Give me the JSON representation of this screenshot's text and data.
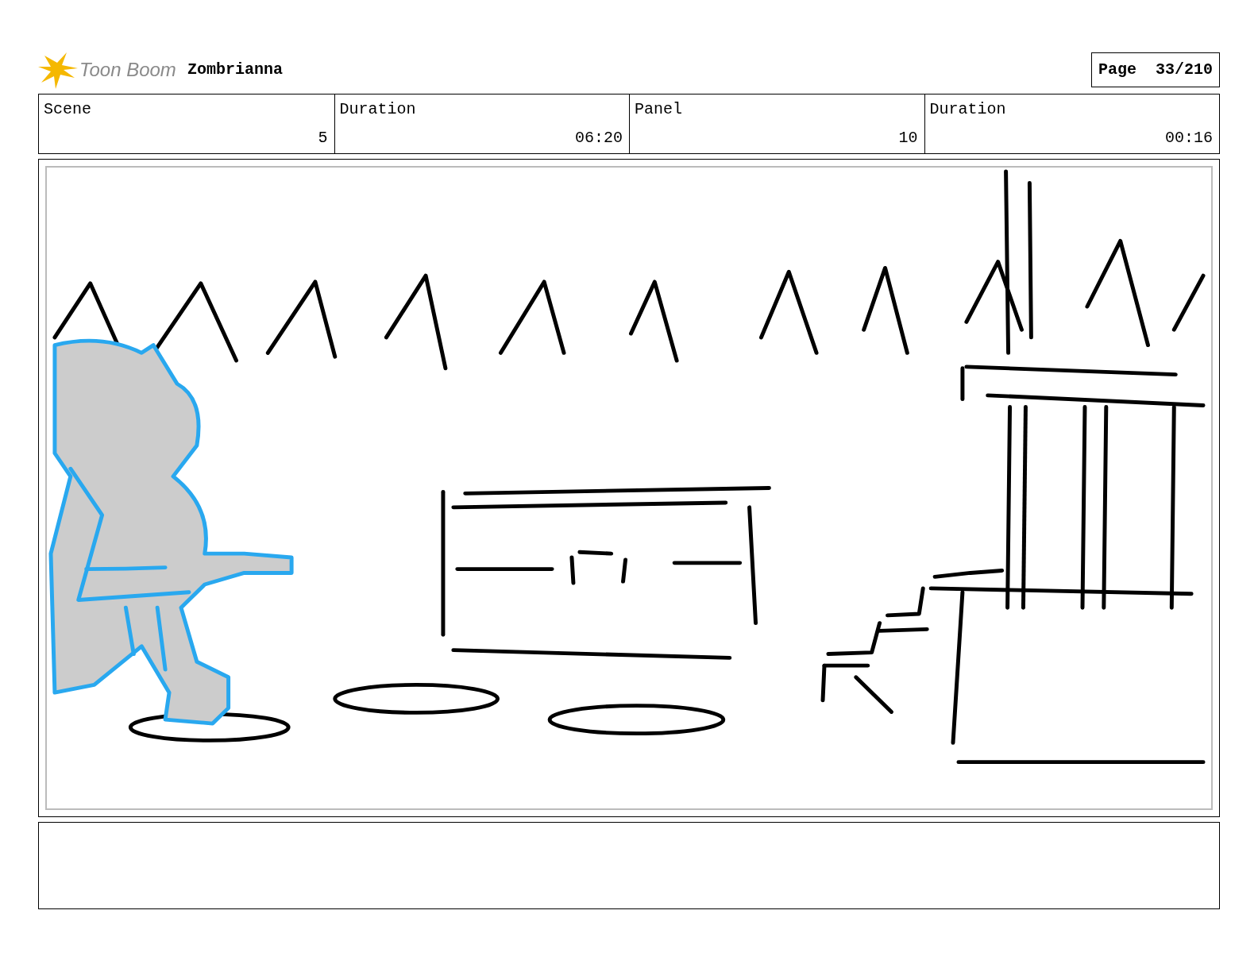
{
  "header": {
    "logo_text": "Toon Boom",
    "project": "Zombrianna",
    "page_label": "Page",
    "page_number": "33/210"
  },
  "info": [
    {
      "heading": "Scene",
      "content": "5"
    },
    {
      "heading": "Duration",
      "content": "06:20"
    },
    {
      "heading": "Panel",
      "content": "10"
    },
    {
      "heading": "Duration",
      "content": "00:16"
    }
  ]
}
